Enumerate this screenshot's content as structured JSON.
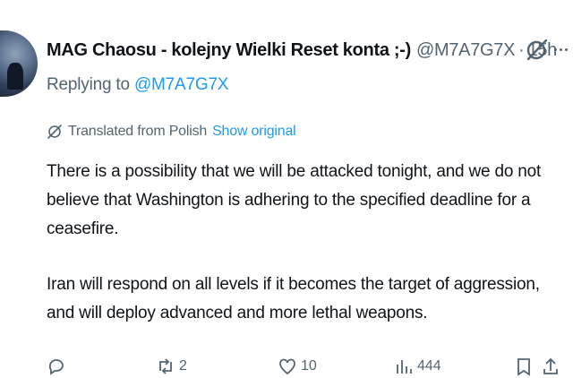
{
  "tweet": {
    "display_name": "MAG Chaosu - kolejny Wielki Reset konta ;-)",
    "handle": "@M7A7G7X",
    "separator": "·",
    "time": "15h",
    "replying_prefix": "Replying to ",
    "replying_to": "@M7A7G7X",
    "translated_label": "Translated from Polish",
    "show_original": "Show original",
    "paragraphs": [
      "There is a possibility that we will be attacked tonight, and we do not believe that Washington is adhering to the specified deadline for a ceasefire.",
      "Iran will respond on all levels if it becomes the target of aggression, and will deploy advanced and more lethal weapons."
    ]
  },
  "actions": {
    "replies": "",
    "reposts": "2",
    "likes": "10",
    "views": "444"
  },
  "colors": {
    "text": "#0f1419",
    "secondary": "#536471",
    "link": "#1d9bf0"
  },
  "icons": [
    "grok-icon",
    "more-icon",
    "translate-icon",
    "reply-icon",
    "repost-icon",
    "like-icon",
    "views-icon",
    "bookmark-icon",
    "share-icon"
  ]
}
